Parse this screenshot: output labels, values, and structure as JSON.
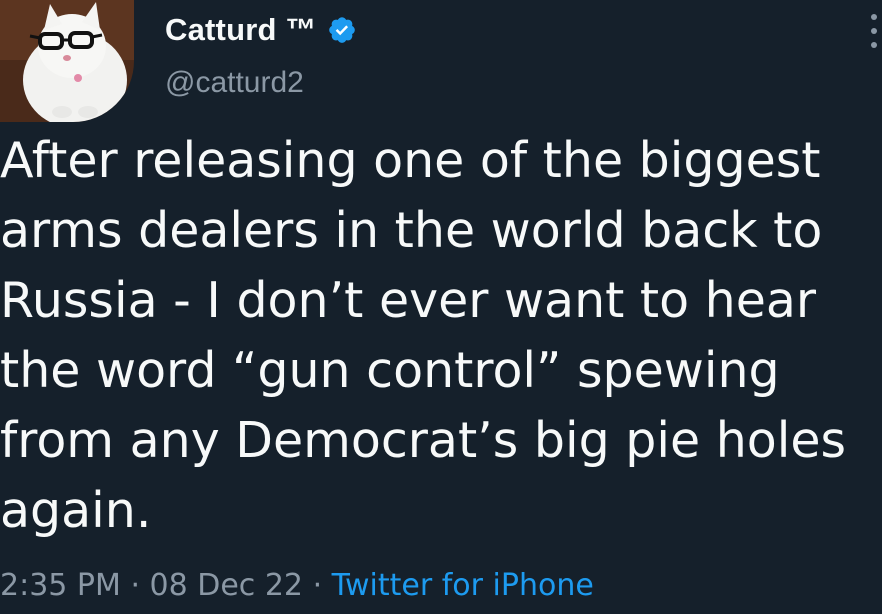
{
  "author": {
    "display_name": "Catturd ™",
    "handle": "@catturd2",
    "verified": true,
    "verified_icon": "verified-badge-icon",
    "verified_color": "#1d9bf0"
  },
  "tweet": {
    "text_lines": [
      "After releasing one of the biggest",
      "arms dealers in the world back to",
      "Russia - I don’t ever want to hear",
      "the word “gun control” spewing",
      "from any Democrat’s big pie holes",
      "again."
    ],
    "time": "2:35 PM",
    "separator": "·",
    "date": "08 Dec 22",
    "source": "Twitter for iPhone"
  },
  "colors": {
    "background": "#15202b",
    "text": "#f7f9f9",
    "secondary_text": "#8b98a5",
    "link": "#1d9bf0"
  },
  "icons": {
    "more": "more-options-icon"
  }
}
